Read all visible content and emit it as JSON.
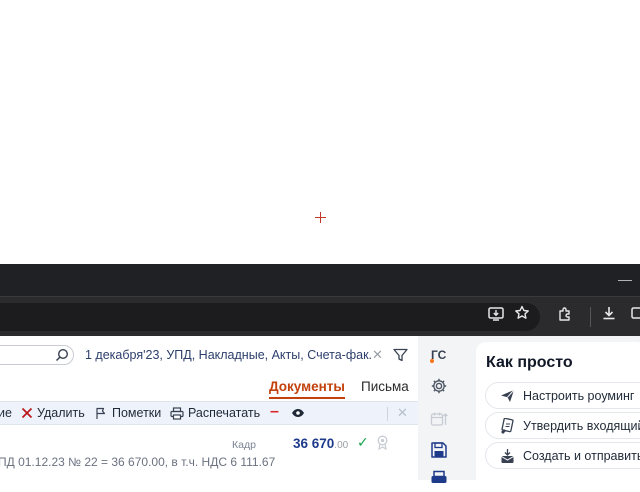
{
  "filter": {
    "text": "1 декабря'23, УПД, Накладные, Акты, Счета-фак..."
  },
  "tabs": {
    "documents": "Документы",
    "letters": "Письма"
  },
  "actions": {
    "partial_left": "ие",
    "delete": "Удалить",
    "marks": "Пометки",
    "print": "Распечатать",
    "minus": "–"
  },
  "document": {
    "kind": "Кадр",
    "amount": "36 670",
    "amount_decimal": ".00",
    "description": "ПД 01.12.23 № 22 = 36 670.00, в т.ч. НДС 6 111.67"
  },
  "iconbar": {
    "user_initials": "ГС"
  },
  "panel": {
    "title": "Как просто",
    "items": [
      {
        "label": "Настроить роуминг",
        "icon": "paper-plane-icon"
      },
      {
        "label": "Утвердить входящий",
        "icon": "sign-document-icon"
      },
      {
        "label": "Создать и отправить",
        "icon": "create-send-icon"
      }
    ]
  },
  "colors": {
    "accent": "#c2410c",
    "amount": "#1e3a8a",
    "ok": "#16a34a",
    "danger": "#dc2626",
    "titlebar": "#202124",
    "toolbar": "#2b2b2e"
  }
}
